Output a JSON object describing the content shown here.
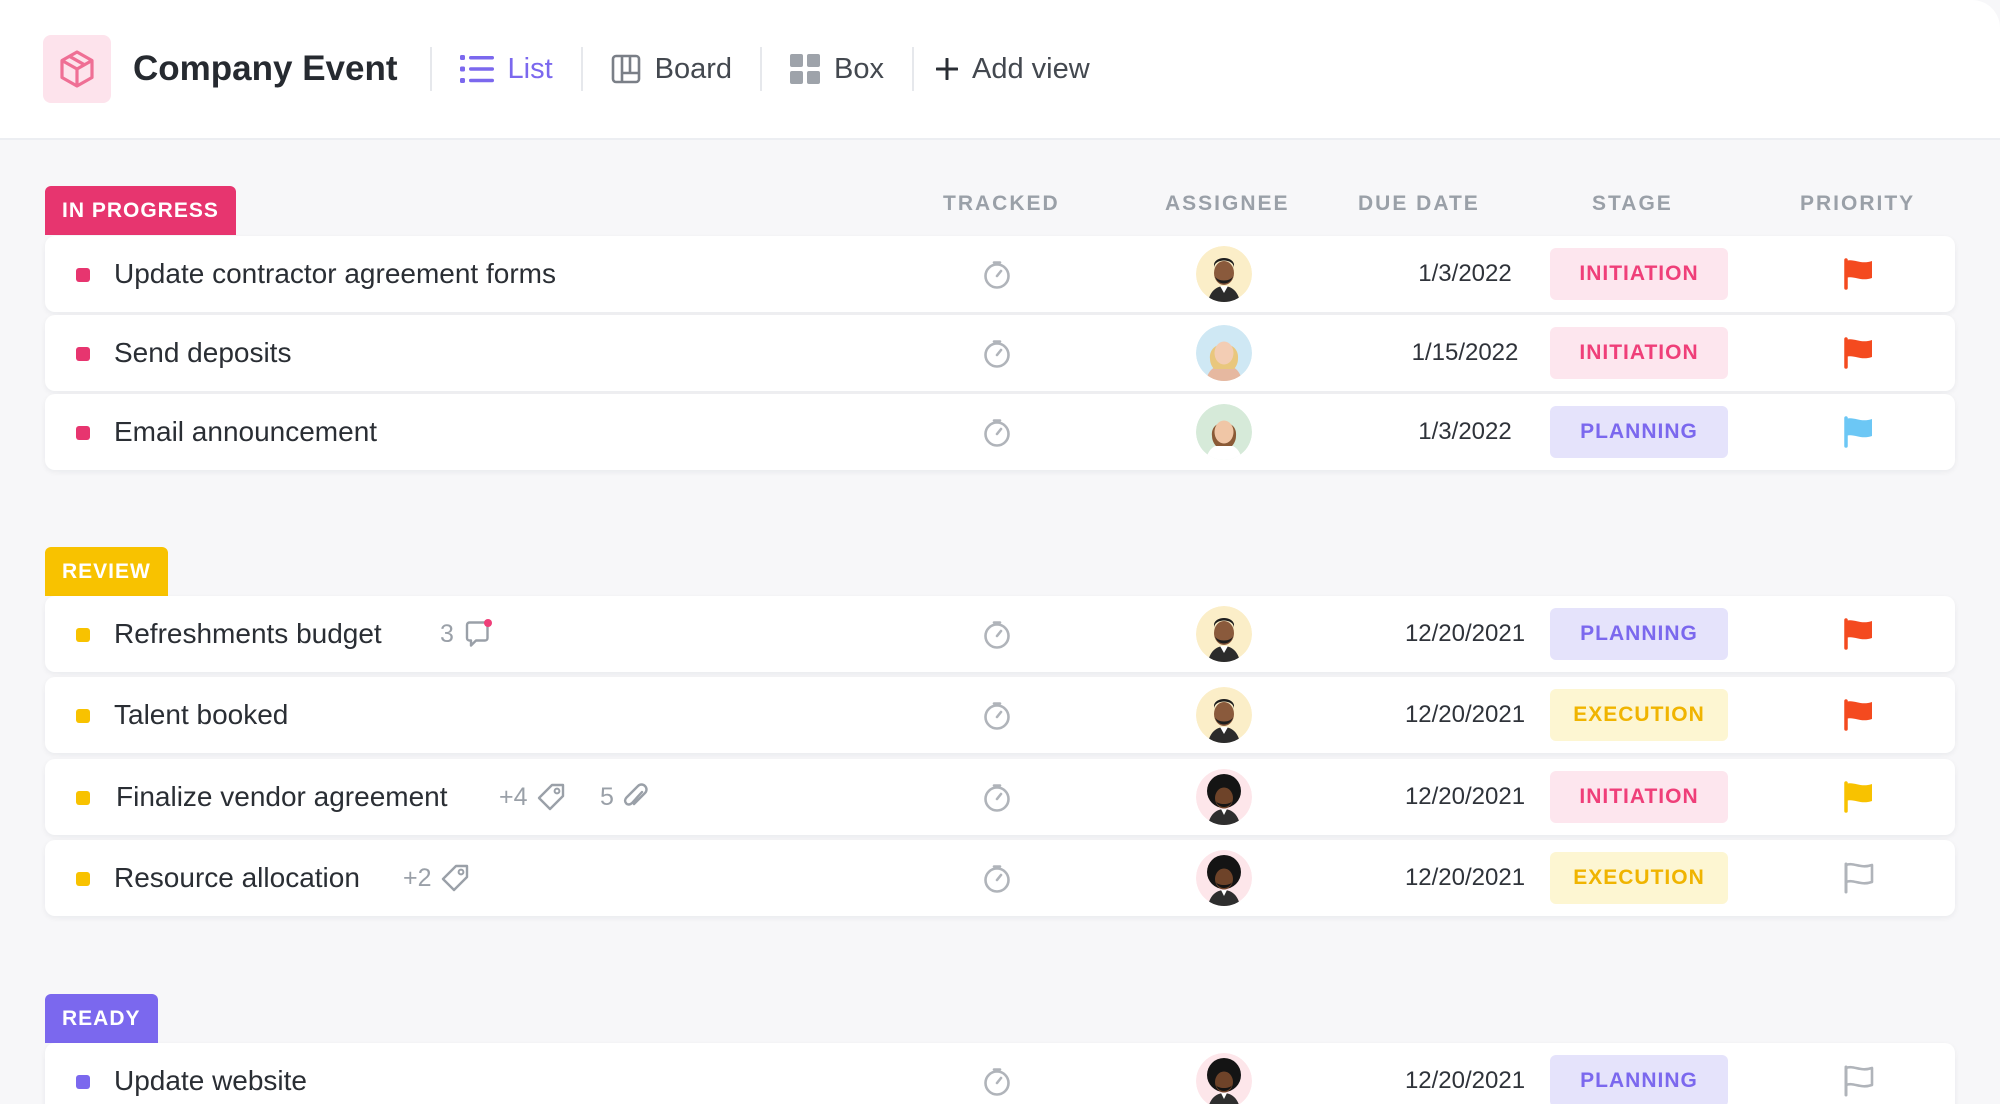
{
  "header": {
    "title": "Company Event",
    "views": [
      {
        "label": "List",
        "icon": "list-icon",
        "active": true
      },
      {
        "label": "Board",
        "icon": "board-icon",
        "active": false
      },
      {
        "label": "Box",
        "icon": "box-grid-icon",
        "active": false
      }
    ],
    "add_view_label": "Add view"
  },
  "columns": {
    "tracked": "TRACKED",
    "assignee": "ASSIGNEE",
    "due_date": "DUE DATE",
    "stage": "STAGE",
    "priority": "PRIORITY"
  },
  "colors": {
    "accent": "#7b68ee",
    "in_progress": "#e7356f",
    "review": "#f8c200",
    "ready": "#7b68ee",
    "flag_urgent": "#f44a1f",
    "flag_high": "#f8c200",
    "flag_normal": "#6cc7f5"
  },
  "groups": [
    {
      "label": "IN PROGRESS",
      "rows": [
        {
          "name": "Update contractor agreement forms",
          "due": "1/3/2022",
          "stage": "INITIATION",
          "priority": "urgent",
          "assignee": "avatar-man-beard"
        },
        {
          "name": "Send deposits",
          "due": "1/15/2022",
          "stage": "INITIATION",
          "priority": "urgent",
          "assignee": "avatar-woman-blonde"
        },
        {
          "name": "Email announcement",
          "due": "1/3/2022",
          "stage": "PLANNING",
          "priority": "normal",
          "assignee": "avatar-woman-brunette"
        }
      ]
    },
    {
      "label": "REVIEW",
      "rows": [
        {
          "name": "Refreshments budget",
          "comments": "3",
          "due": "12/20/2021",
          "stage": "PLANNING",
          "priority": "urgent",
          "assignee": "avatar-man-beard"
        },
        {
          "name": "Talent booked",
          "due": "12/20/2021",
          "stage": "EXECUTION",
          "priority": "urgent",
          "assignee": "avatar-man-beard"
        },
        {
          "name": "Finalize vendor agreement",
          "tags": "+4",
          "attachments": "5",
          "due": "12/20/2021",
          "stage": "INITIATION",
          "priority": "high",
          "assignee": "avatar-man-afro"
        },
        {
          "name": "Resource allocation",
          "tags": "+2",
          "due": "12/20/2021",
          "stage": "EXECUTION",
          "priority": "none",
          "assignee": "avatar-man-afro"
        }
      ]
    },
    {
      "label": "READY",
      "rows": [
        {
          "name": "Update website",
          "due": "12/20/2021",
          "stage": "PLANNING",
          "priority": "none",
          "assignee": "avatar-man-afro"
        }
      ]
    }
  ]
}
